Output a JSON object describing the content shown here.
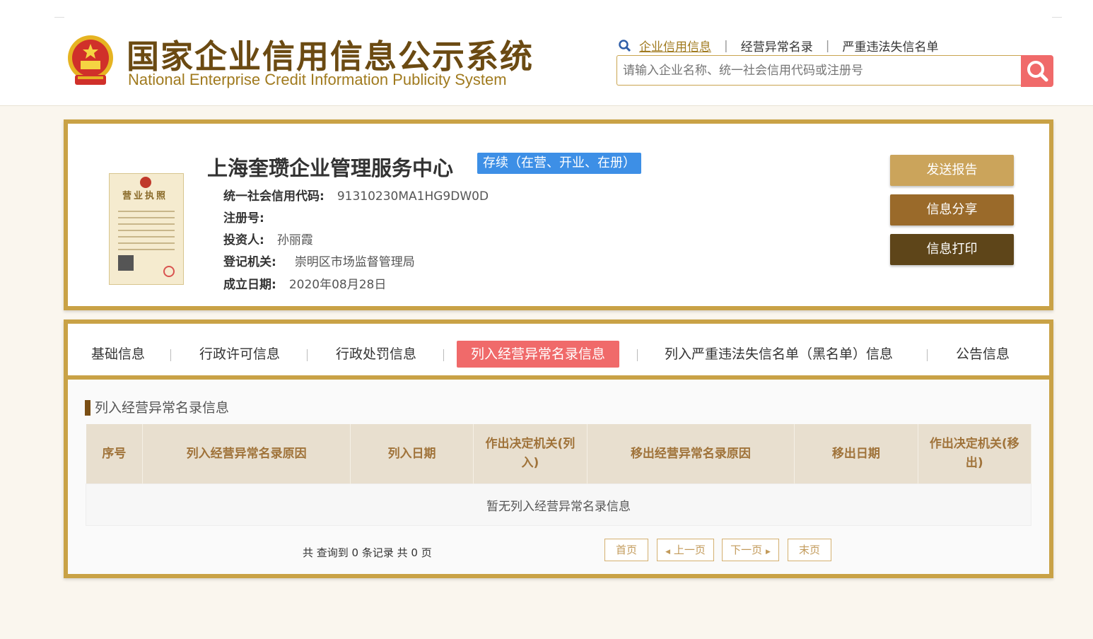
{
  "header": {
    "title_cn": "国家企业信用信息公示系统",
    "title_en": "National Enterprise Credit Information Publicity System",
    "links": [
      "企业信用信息",
      "经营异常名录",
      "严重违法失信名单"
    ],
    "search_placeholder": "请输入企业名称、统一社会信用代码或注册号"
  },
  "company": {
    "name": "上海奎瓒企业管理服务中心",
    "status": "存续（在营、开业、在册）",
    "license_title": "营业执照",
    "fields": [
      {
        "label": "统一社会信用代码:",
        "value": "91310230MA1HG9DW0D"
      },
      {
        "label": "注册号:",
        "value": ""
      },
      {
        "label": "投资人:",
        "value": "孙丽霞"
      },
      {
        "label": "登记机关:",
        "value": "崇明区市场监督管理局"
      },
      {
        "label": "成立日期:",
        "value": "2020年08月28日"
      }
    ],
    "buttons": {
      "send": "发送报告",
      "share": "信息分享",
      "print": "信息打印"
    }
  },
  "tabs": [
    "基础信息",
    "行政许可信息",
    "行政处罚信息",
    "列入经营异常名录信息",
    "列入严重违法失信名单（黑名单）信息",
    "公告信息"
  ],
  "active_tab": "列入经营异常名录信息",
  "section": {
    "title": "列入经营异常名录信息",
    "columns": [
      "序号",
      "列入经营异常名录原因",
      "列入日期",
      "作出决定机关(列入)",
      "移出经营异常名录原因",
      "移出日期",
      "作出决定机关(移出)"
    ],
    "empty_text": "暂无列入经营异常名录信息"
  },
  "pager": {
    "summary": "共 查询到 0 条记录 共 0 页",
    "first": "首页",
    "prev": "上一页",
    "next": "下一页",
    "last": "末页"
  },
  "colors": {
    "gold": "#c9a246",
    "active_tab": "#f06a6a",
    "status_badge": "#3d8fe6"
  }
}
